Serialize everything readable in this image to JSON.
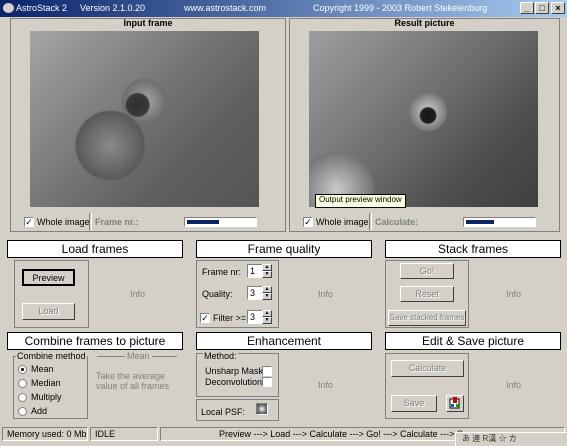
{
  "window": {
    "app_title": "AstroStack 2",
    "version": "Version 2.1.0.20",
    "website": "www.astrostack.com",
    "copyright": "Copyright 1999  -  2003   Robert Stekelenburg",
    "minimize": "_",
    "maximize": "□",
    "close": "×"
  },
  "input_frame": {
    "title": "Input frame",
    "whole_image_label": "Whole image",
    "whole_image_checked": true,
    "frame_nr_label": "Frame nr.:",
    "progress": 0.5
  },
  "result_picture": {
    "title": "Result picture",
    "whole_image_label": "Whole image",
    "whole_image_checked": true,
    "calculate_label": "Calculate:",
    "progress": 0.45,
    "tooltip": "Output preview window"
  },
  "load_frames": {
    "title": "Load frames",
    "preview_button": "Preview",
    "load_button": "Load",
    "info": "Info"
  },
  "frame_quality": {
    "title": "Frame quality",
    "frame_nr_label": "Frame nr:",
    "frame_nr_value": "1",
    "quality_label": "Quality:",
    "quality_value": "3",
    "filter_label": "Filter >=",
    "filter_checked": true,
    "filter_value": "3",
    "info": "Info"
  },
  "stack_frames": {
    "title": "Stack frames",
    "go_button": "Go!",
    "reset_button": "Reset",
    "save_button": "Save stacked frames",
    "info": "Info"
  },
  "combine": {
    "title": "Combine frames to picture",
    "group_label": "Combine method",
    "methods": [
      "Mean",
      "Median",
      "Multiply",
      "Add"
    ],
    "selected": "Mean",
    "mean_heading": "Mean",
    "description": "Take the average value of all frames"
  },
  "enhancement": {
    "title": "Enhancement",
    "method_label": "Method:",
    "unsharp_mask_label": "Unsharp Mask:",
    "deconvolution_label": "Deconvolution",
    "local_psf_label": "Local PSF:",
    "info": "Info"
  },
  "edit_save": {
    "title": "Edit & Save picture",
    "calculate_button": "Calculate",
    "save_button": "Save",
    "info": "Info"
  },
  "statusbar": {
    "memory": "Memory used: 0 Mb",
    "state": "IDLE",
    "workflow": "Preview      --->   Load      --->   Calculate      --->   Go!      --->   Calculate      --->   S",
    "tray_text": "あ 連 R漢 ☆ カ"
  },
  "colors": {
    "titlebar_start": "#0a246a",
    "titlebar_end": "#a6caf0",
    "window_bg": "#d4d0c8",
    "progress_fill": "#0a246a"
  }
}
